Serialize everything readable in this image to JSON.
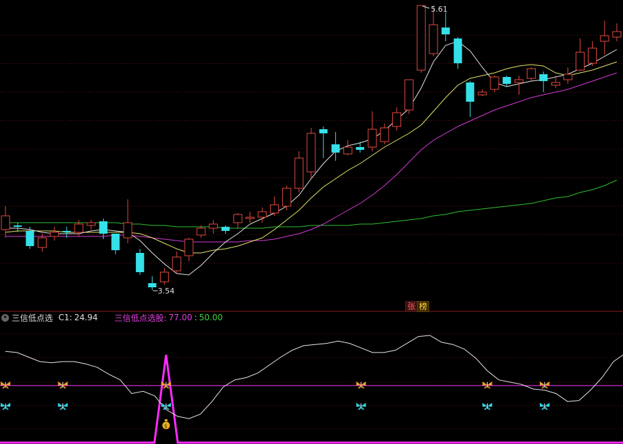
{
  "price_chart": {
    "high_label": "5.61",
    "low_label": "3.54",
    "candles": [
      [
        3.98,
        4.08,
        4.15,
        3.92
      ],
      [
        4.01,
        4.0,
        4.03,
        3.96
      ],
      [
        3.97,
        3.86,
        4.0,
        3.84
      ],
      [
        3.85,
        3.92,
        3.95,
        3.82
      ],
      [
        3.93,
        3.96,
        4.0,
        3.9
      ],
      [
        3.97,
        3.96,
        4.0,
        3.92
      ],
      [
        3.96,
        4.02,
        4.05,
        3.93
      ],
      [
        4.01,
        4.03,
        4.05,
        3.98
      ],
      [
        4.04,
        3.95,
        4.06,
        3.91
      ],
      [
        3.95,
        3.83,
        3.95,
        3.8
      ],
      [
        3.92,
        4.03,
        4.2,
        3.88
      ],
      [
        3.81,
        3.67,
        3.84,
        3.65
      ],
      [
        3.59,
        3.56,
        3.64,
        3.54
      ],
      [
        3.6,
        3.67,
        3.7,
        3.58
      ],
      [
        3.68,
        3.78,
        3.82,
        3.66
      ],
      [
        3.79,
        3.91,
        3.92,
        3.75
      ],
      [
        3.94,
        3.99,
        4.01,
        3.92
      ],
      [
        3.99,
        4.02,
        4.05,
        3.95
      ],
      [
        4.0,
        3.97,
        4.01,
        3.95
      ],
      [
        4.03,
        4.09,
        4.1,
        3.99
      ],
      [
        4.06,
        4.07,
        4.11,
        4.03
      ],
      [
        4.07,
        4.11,
        4.14,
        4.03
      ],
      [
        4.1,
        4.16,
        4.22,
        4.08
      ],
      [
        4.15,
        4.28,
        4.3,
        4.12
      ],
      [
        4.28,
        4.5,
        4.55,
        4.25
      ],
      [
        4.4,
        4.68,
        4.72,
        4.35
      ],
      [
        4.71,
        4.68,
        4.73,
        4.5
      ],
      [
        4.6,
        4.54,
        4.69,
        4.48
      ],
      [
        4.53,
        4.58,
        4.63,
        4.52
      ],
      [
        4.58,
        4.56,
        4.62,
        4.54
      ],
      [
        4.58,
        4.71,
        4.84,
        4.55
      ],
      [
        4.62,
        4.72,
        4.75,
        4.6
      ],
      [
        4.73,
        4.83,
        4.87,
        4.7
      ],
      [
        4.85,
        5.07,
        5.07,
        4.82
      ],
      [
        5.14,
        5.61,
        5.61,
        5.12
      ],
      [
        5.26,
        5.47,
        5.61,
        5.24
      ],
      [
        5.45,
        5.4,
        5.56,
        5.35
      ],
      [
        5.37,
        5.19,
        5.38,
        5.15
      ],
      [
        5.05,
        4.91,
        5.06,
        4.8
      ],
      [
        4.96,
        4.98,
        5.0,
        4.95
      ],
      [
        5.0,
        5.09,
        5.1,
        4.98
      ],
      [
        5.09,
        5.04,
        5.1,
        5.02
      ],
      [
        5.05,
        5.07,
        5.1,
        4.96
      ],
      [
        5.08,
        5.15,
        5.16,
        5.06
      ],
      [
        5.11,
        5.06,
        5.13,
        4.98
      ],
      [
        5.03,
        5.05,
        5.1,
        5.01
      ],
      [
        5.07,
        5.11,
        5.16,
        5.04
      ],
      [
        5.14,
        5.27,
        5.37,
        5.13
      ],
      [
        5.19,
        5.3,
        5.35,
        5.17
      ],
      [
        5.35,
        5.39,
        5.5,
        5.25
      ],
      [
        5.38,
        5.42,
        5.48,
        5.35
      ]
    ],
    "ma_white": [
      3.99,
      3.99,
      3.98,
      3.96,
      3.95,
      3.95,
      3.95,
      3.97,
      3.98,
      3.97,
      3.96,
      3.9,
      3.81,
      3.73,
      3.66,
      3.65,
      3.72,
      3.81,
      3.89,
      3.95,
      4.02,
      4.06,
      4.1,
      4.15,
      4.23,
      4.35,
      4.46,
      4.55,
      4.59,
      4.61,
      4.64,
      4.7,
      4.78,
      4.86,
      5.01,
      5.2,
      5.32,
      5.35,
      5.28,
      5.16,
      5.05,
      5.02,
      5.04,
      5.06,
      5.07,
      5.09,
      5.11,
      5.15,
      5.19,
      5.24,
      5.29
    ],
    "ma_yellow": [
      3.96,
      3.97,
      3.97,
      3.97,
      3.97,
      3.96,
      3.96,
      3.96,
      3.96,
      3.96,
      3.96,
      3.95,
      3.92,
      3.88,
      3.84,
      3.81,
      3.81,
      3.83,
      3.84,
      3.86,
      3.89,
      3.92,
      3.98,
      4.05,
      4.12,
      4.21,
      4.29,
      4.35,
      4.41,
      4.46,
      4.52,
      4.58,
      4.63,
      4.68,
      4.74,
      4.84,
      4.94,
      5.03,
      5.08,
      5.1,
      5.12,
      5.15,
      5.17,
      5.18,
      5.17,
      5.12,
      5.1,
      5.12,
      5.14,
      5.17,
      5.2
    ],
    "ma_magenta": [
      3.93,
      3.93,
      3.93,
      3.93,
      3.93,
      3.93,
      3.93,
      3.93,
      3.93,
      3.94,
      3.94,
      3.93,
      3.92,
      3.91,
      3.9,
      3.89,
      3.89,
      3.89,
      3.89,
      3.89,
      3.9,
      3.9,
      3.91,
      3.93,
      3.95,
      3.98,
      4.02,
      4.07,
      4.12,
      4.17,
      4.23,
      4.3,
      4.38,
      4.47,
      4.56,
      4.63,
      4.68,
      4.73,
      4.77,
      4.81,
      4.85,
      4.88,
      4.91,
      4.94,
      4.96,
      4.98,
      5.0,
      5.03,
      5.06,
      5.09,
      5.12
    ],
    "ma_green": [
      4.03,
      4.03,
      4.03,
      4.03,
      4.03,
      4.03,
      4.03,
      4.03,
      4.03,
      4.03,
      4.02,
      4.02,
      4.01,
      4.01,
      4.0,
      4.0,
      4.0,
      4.0,
      3.99,
      3.99,
      3.99,
      3.99,
      4.0,
      4.0,
      4.0,
      4.01,
      4.01,
      4.01,
      4.01,
      4.02,
      4.02,
      4.03,
      4.04,
      4.05,
      4.06,
      4.08,
      4.09,
      4.11,
      4.12,
      4.13,
      4.14,
      4.15,
      4.16,
      4.17,
      4.19,
      4.21,
      4.22,
      4.25,
      4.27,
      4.3,
      4.34
    ],
    "y_min": 3.49,
    "y_max": 5.63
  },
  "badges": {
    "zhang": "张",
    "bang": "榜"
  },
  "indicator": {
    "name": "三信低点选",
    "c1_label": "C1:",
    "c1_value": "24.94",
    "xg_label": "三信低点选股:",
    "xg_value1": "77.00",
    "xg_sep": ":",
    "xg_value2": "50.00",
    "level_value": 50.0,
    "line_values": [
      80,
      79,
      75,
      71,
      70,
      71,
      71,
      69,
      66,
      60,
      55,
      43,
      45,
      41,
      29,
      23,
      21,
      25,
      36,
      49,
      55,
      57,
      61,
      68,
      75,
      81,
      85,
      86,
      87,
      89,
      87,
      83,
      79,
      79,
      81,
      87,
      93,
      94,
      88,
      86,
      82,
      74,
      63,
      55,
      53,
      51,
      47,
      46,
      43,
      36,
      37,
      46,
      57,
      71,
      78
    ],
    "spike_index": 14,
    "spike_value": 77.0,
    "butterfly_up_idx": [
      0,
      5,
      14,
      31,
      42,
      47
    ],
    "butterfly_down_idx": [
      0,
      5,
      14,
      31,
      42,
      47
    ],
    "moneybag_idx": 14,
    "y_min": 0,
    "y_max": 100
  },
  "colors": {
    "up": "#e24a3f",
    "down": "#35e0e8",
    "ma_white": "#e6e6e6",
    "ma_yellow": "#e6e66a",
    "ma_magenta": "#d63bd6",
    "ma_green": "#2fc22f",
    "grid": "#6b1818",
    "separator": "#8a1c1c",
    "indicator_line": "#e8e8e8",
    "level_line": "#ff3cff",
    "spike": "#ff2cff",
    "c1_text": "#e0e0e0",
    "xg_text": "#e040e0",
    "xg_value1": "#e040e0",
    "xg_value2": "#3fd23f"
  }
}
